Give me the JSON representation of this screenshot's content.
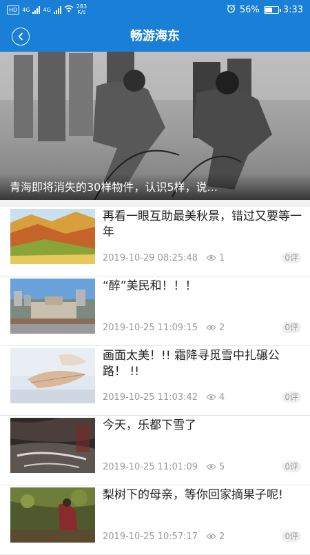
{
  "status_bar": {
    "network_badge": "HD",
    "signal1_label": "4G",
    "signal2_label": "4G",
    "speed_value": "283",
    "speed_unit": "K/s",
    "battery_percent": "56%",
    "battery_level": 0.56,
    "time": "3:33"
  },
  "navbar": {
    "title": "畅游海东",
    "back_icon": "chevron-left-icon"
  },
  "banner": {
    "caption": "青海即将消失的30样物件，认识5样，说..."
  },
  "articles": [
    {
      "title": "再看一眼互助最美秋景，错过又要等一年",
      "date": "2019-10-29 08:25:48",
      "views": "1",
      "comments": "0评"
    },
    {
      "title": "“醉”美民和！！！",
      "date": "2019-10-25 11:09:15",
      "views": "2",
      "comments": "0评"
    },
    {
      "title": "画面太美！!! 霜降寻觅雪中扎碾公路！ !!",
      "date": "2019-10-25 11:03:42",
      "views": "4",
      "comments": "0评"
    },
    {
      "title": "今天，乐都下雪了",
      "date": "2019-10-25 11:01:09",
      "views": "5",
      "comments": "0评"
    },
    {
      "title": "梨树下的母亲，等你回家摘果子呢!",
      "date": "2019-10-25 10:57:17",
      "views": "2",
      "comments": "0评"
    }
  ],
  "colors": {
    "primary": "#1a7fd6",
    "meta_text": "#999999",
    "title_text": "#222222"
  }
}
